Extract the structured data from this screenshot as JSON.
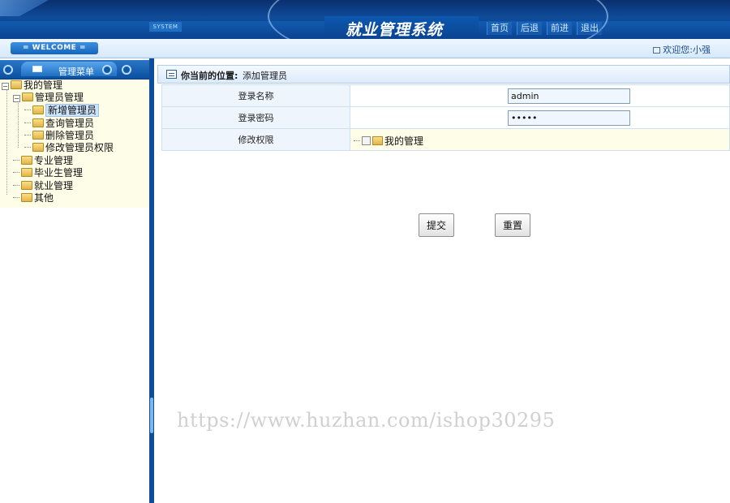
{
  "header": {
    "system_tag": "SYSTEM",
    "title": "就业管理系统",
    "nav": [
      "首页",
      "后退",
      "前进",
      "退出"
    ]
  },
  "welcome": {
    "badge": "= WELCOME =",
    "user": "欢迎您:小强"
  },
  "sidebar": {
    "menu_label": "管理菜单",
    "tree": {
      "root": "我的管理",
      "admin_group": "管理员管理",
      "admin_items": [
        "新增管理员",
        "查询管理员",
        "删除管理员",
        "修改管理员权限"
      ],
      "other_groups": [
        "专业管理",
        "毕业生管理",
        "就业管理",
        "其他"
      ]
    }
  },
  "main": {
    "location_label": "你当前的位置:",
    "location_value": "添加管理员",
    "rows": [
      {
        "label": "登录名称",
        "value": "admin"
      },
      {
        "label": "登录密码",
        "value": "•••••"
      },
      {
        "label": "修改权限",
        "value": "我的管理"
      }
    ],
    "submit_label": "提交",
    "reset_label": "重置"
  },
  "watermark": "https://www.huzhan.com/ishop30295",
  "colors": {
    "header_blue": "#0f4c9a",
    "tree_bg": "#fefde8",
    "label_bg": "#eef5fd"
  },
  "icons": {
    "folder": "folder-icon",
    "mail": "mail-icon",
    "user": "user-icon",
    "location": "location-icon"
  }
}
